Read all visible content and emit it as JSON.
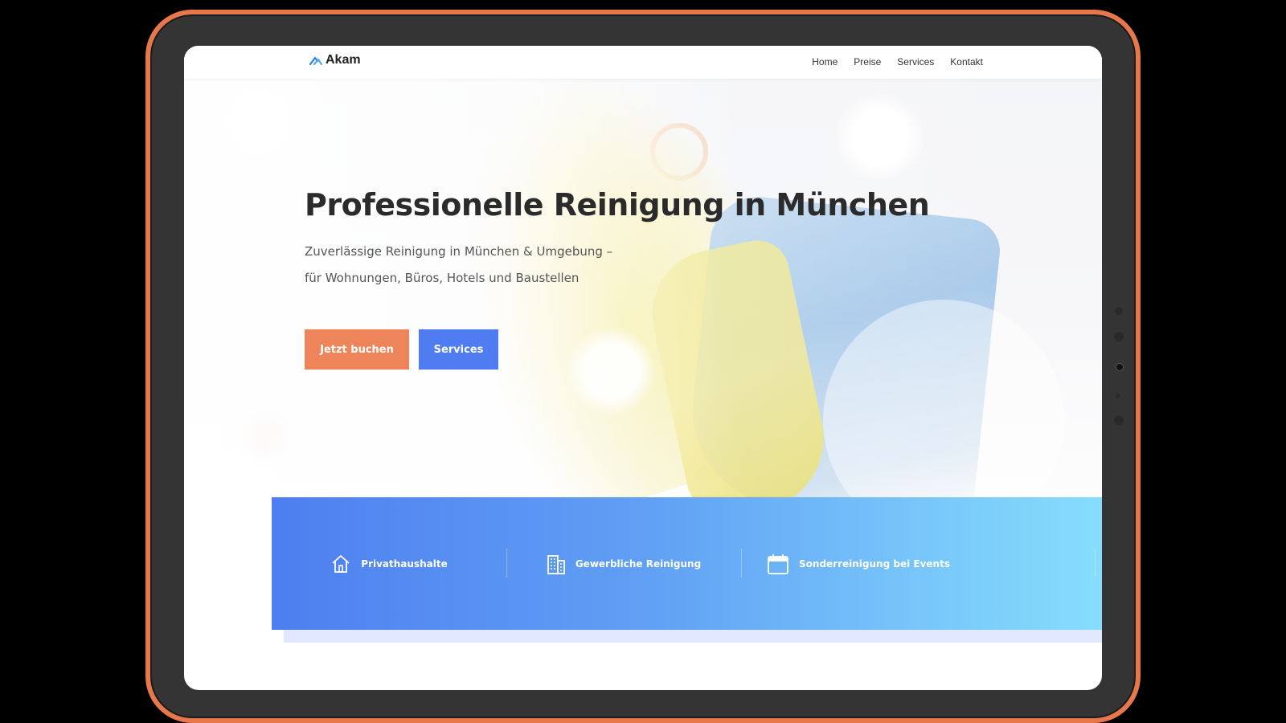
{
  "brand": {
    "name": "Akam"
  },
  "nav": {
    "items": [
      {
        "label": "Home"
      },
      {
        "label": "Preise"
      },
      {
        "label": "Services"
      },
      {
        "label": "Kontakt"
      }
    ]
  },
  "hero": {
    "title": "Professionelle Reinigung in München",
    "subtitle_line1": "Zuverlässige Reinigung in München & Umgebung –",
    "subtitle_line2": "für Wohnungen, Büros, Hotels und Baustellen",
    "primary_button": "Jetzt buchen",
    "secondary_button": "Services"
  },
  "features": [
    {
      "label": "Privathaushalte",
      "icon": "house-icon"
    },
    {
      "label": "Gewerbliche Reinigung",
      "icon": "building-icon"
    },
    {
      "label": "Sonderreinigung bei Events",
      "icon": "calendar-icon"
    }
  ],
  "colors": {
    "accent_orange": "#ee845a",
    "accent_blue": "#4f7cf0",
    "frame_orange": "#e8774a",
    "features_gradient_start": "#4e7ef0",
    "features_gradient_end": "#86ddfb"
  }
}
